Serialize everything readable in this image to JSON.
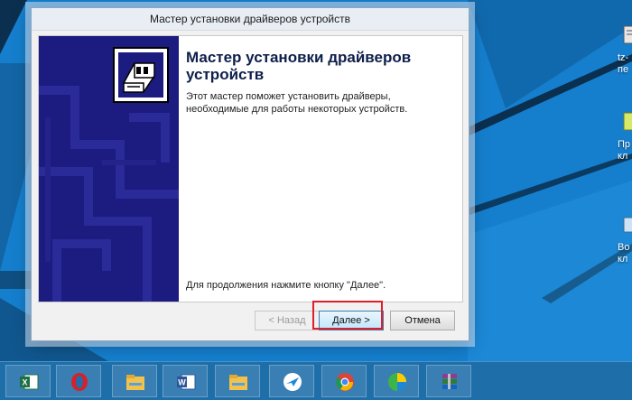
{
  "window": {
    "title": "Мастер установки драйверов устройств",
    "heading": "Мастер установки драйверов устройств",
    "description": "Этот мастер поможет установить драйверы, необходимые для работы некоторых устройств.",
    "hint": "Для продолжения нажмите кнопку \"Далее\"."
  },
  "buttons": {
    "back": "< Назад",
    "next": "Далее >",
    "cancel": "Отмена"
  },
  "desktop_icons": [
    {
      "label": "tz-\nпе",
      "icon": "file-icon"
    },
    {
      "label": "Пр\nкл",
      "icon": "document-icon"
    },
    {
      "label": "Во\nкл",
      "icon": "shortcut-icon"
    }
  ],
  "taskbar": {
    "apps": [
      {
        "icon": "excel-icon"
      },
      {
        "icon": "opera-icon"
      },
      {
        "icon": "file-explorer-icon"
      },
      {
        "icon": "word-icon"
      },
      {
        "icon": "file-explorer-icon"
      },
      {
        "icon": "bird-app-icon"
      },
      {
        "icon": "chrome-icon"
      },
      {
        "icon": "colorful-ball-icon"
      },
      {
        "icon": "winrar-icon"
      }
    ]
  },
  "colors": {
    "desktop": "#1a87d6",
    "banner": "#1c1b80",
    "highlight": "#e11d2a",
    "taskbar": "#1e6ea9"
  }
}
